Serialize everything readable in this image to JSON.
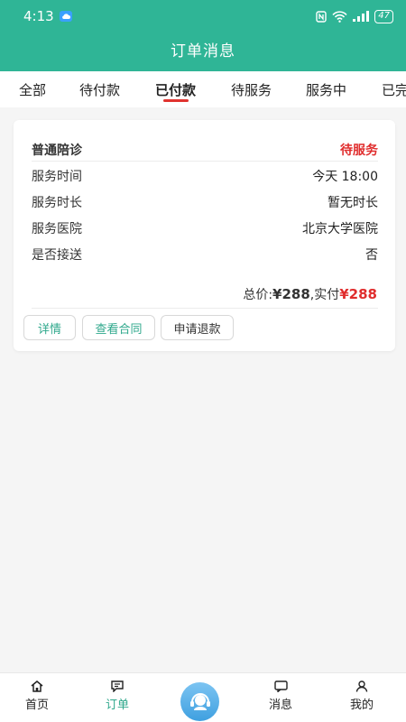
{
  "status_bar": {
    "time": "4:13",
    "battery": "47"
  },
  "header": {
    "title": "订单消息"
  },
  "tabs": [
    {
      "label": "全部"
    },
    {
      "label": "待付款"
    },
    {
      "label": "已付款",
      "active": true
    },
    {
      "label": "待服务"
    },
    {
      "label": "服务中"
    },
    {
      "label": "已完"
    }
  ],
  "order": {
    "service_name": "普通陪诊",
    "status": "待服务",
    "rows": [
      {
        "label": "服务时间",
        "value": "今天 18:00"
      },
      {
        "label": "服务时长",
        "value": "暂无时长"
      },
      {
        "label": "服务医院",
        "value": "北京大学医院"
      },
      {
        "label": "是否接送",
        "value": "否"
      }
    ],
    "total_label": "总价:",
    "total_amount": "¥288",
    "paid_label": ",实付",
    "paid_amount": "¥288",
    "buttons": {
      "detail": "详情",
      "contract": "查看合同",
      "refund": "申请退款"
    }
  },
  "bottom_nav": {
    "home": "首页",
    "orders": "订单",
    "messages": "消息",
    "mine": "我的"
  },
  "colors": {
    "brand": "#2fb596",
    "accent_red": "#e02d2d",
    "nav_active": "#2fa88c"
  }
}
